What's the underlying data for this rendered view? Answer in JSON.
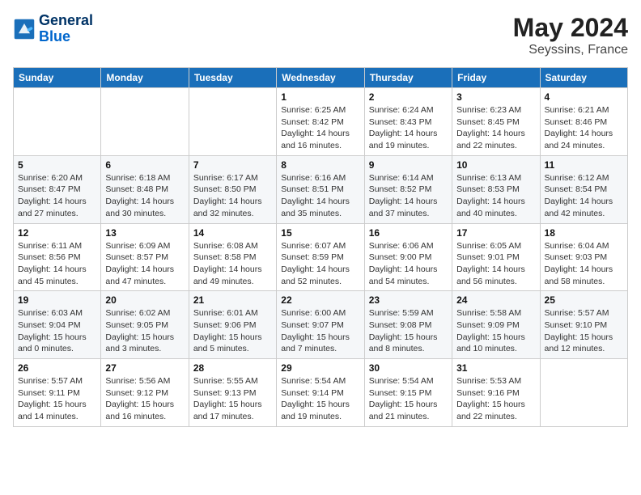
{
  "header": {
    "logo_line1": "General",
    "logo_line2": "Blue",
    "month_year": "May 2024",
    "location": "Seyssins, France"
  },
  "weekdays": [
    "Sunday",
    "Monday",
    "Tuesday",
    "Wednesday",
    "Thursday",
    "Friday",
    "Saturday"
  ],
  "weeks": [
    [
      {
        "day": "",
        "info": ""
      },
      {
        "day": "",
        "info": ""
      },
      {
        "day": "",
        "info": ""
      },
      {
        "day": "1",
        "info": "Sunrise: 6:25 AM\nSunset: 8:42 PM\nDaylight: 14 hours\nand 16 minutes."
      },
      {
        "day": "2",
        "info": "Sunrise: 6:24 AM\nSunset: 8:43 PM\nDaylight: 14 hours\nand 19 minutes."
      },
      {
        "day": "3",
        "info": "Sunrise: 6:23 AM\nSunset: 8:45 PM\nDaylight: 14 hours\nand 22 minutes."
      },
      {
        "day": "4",
        "info": "Sunrise: 6:21 AM\nSunset: 8:46 PM\nDaylight: 14 hours\nand 24 minutes."
      }
    ],
    [
      {
        "day": "5",
        "info": "Sunrise: 6:20 AM\nSunset: 8:47 PM\nDaylight: 14 hours\nand 27 minutes."
      },
      {
        "day": "6",
        "info": "Sunrise: 6:18 AM\nSunset: 8:48 PM\nDaylight: 14 hours\nand 30 minutes."
      },
      {
        "day": "7",
        "info": "Sunrise: 6:17 AM\nSunset: 8:50 PM\nDaylight: 14 hours\nand 32 minutes."
      },
      {
        "day": "8",
        "info": "Sunrise: 6:16 AM\nSunset: 8:51 PM\nDaylight: 14 hours\nand 35 minutes."
      },
      {
        "day": "9",
        "info": "Sunrise: 6:14 AM\nSunset: 8:52 PM\nDaylight: 14 hours\nand 37 minutes."
      },
      {
        "day": "10",
        "info": "Sunrise: 6:13 AM\nSunset: 8:53 PM\nDaylight: 14 hours\nand 40 minutes."
      },
      {
        "day": "11",
        "info": "Sunrise: 6:12 AM\nSunset: 8:54 PM\nDaylight: 14 hours\nand 42 minutes."
      }
    ],
    [
      {
        "day": "12",
        "info": "Sunrise: 6:11 AM\nSunset: 8:56 PM\nDaylight: 14 hours\nand 45 minutes."
      },
      {
        "day": "13",
        "info": "Sunrise: 6:09 AM\nSunset: 8:57 PM\nDaylight: 14 hours\nand 47 minutes."
      },
      {
        "day": "14",
        "info": "Sunrise: 6:08 AM\nSunset: 8:58 PM\nDaylight: 14 hours\nand 49 minutes."
      },
      {
        "day": "15",
        "info": "Sunrise: 6:07 AM\nSunset: 8:59 PM\nDaylight: 14 hours\nand 52 minutes."
      },
      {
        "day": "16",
        "info": "Sunrise: 6:06 AM\nSunset: 9:00 PM\nDaylight: 14 hours\nand 54 minutes."
      },
      {
        "day": "17",
        "info": "Sunrise: 6:05 AM\nSunset: 9:01 PM\nDaylight: 14 hours\nand 56 minutes."
      },
      {
        "day": "18",
        "info": "Sunrise: 6:04 AM\nSunset: 9:03 PM\nDaylight: 14 hours\nand 58 minutes."
      }
    ],
    [
      {
        "day": "19",
        "info": "Sunrise: 6:03 AM\nSunset: 9:04 PM\nDaylight: 15 hours\nand 0 minutes."
      },
      {
        "day": "20",
        "info": "Sunrise: 6:02 AM\nSunset: 9:05 PM\nDaylight: 15 hours\nand 3 minutes."
      },
      {
        "day": "21",
        "info": "Sunrise: 6:01 AM\nSunset: 9:06 PM\nDaylight: 15 hours\nand 5 minutes."
      },
      {
        "day": "22",
        "info": "Sunrise: 6:00 AM\nSunset: 9:07 PM\nDaylight: 15 hours\nand 7 minutes."
      },
      {
        "day": "23",
        "info": "Sunrise: 5:59 AM\nSunset: 9:08 PM\nDaylight: 15 hours\nand 8 minutes."
      },
      {
        "day": "24",
        "info": "Sunrise: 5:58 AM\nSunset: 9:09 PM\nDaylight: 15 hours\nand 10 minutes."
      },
      {
        "day": "25",
        "info": "Sunrise: 5:57 AM\nSunset: 9:10 PM\nDaylight: 15 hours\nand 12 minutes."
      }
    ],
    [
      {
        "day": "26",
        "info": "Sunrise: 5:57 AM\nSunset: 9:11 PM\nDaylight: 15 hours\nand 14 minutes."
      },
      {
        "day": "27",
        "info": "Sunrise: 5:56 AM\nSunset: 9:12 PM\nDaylight: 15 hours\nand 16 minutes."
      },
      {
        "day": "28",
        "info": "Sunrise: 5:55 AM\nSunset: 9:13 PM\nDaylight: 15 hours\nand 17 minutes."
      },
      {
        "day": "29",
        "info": "Sunrise: 5:54 AM\nSunset: 9:14 PM\nDaylight: 15 hours\nand 19 minutes."
      },
      {
        "day": "30",
        "info": "Sunrise: 5:54 AM\nSunset: 9:15 PM\nDaylight: 15 hours\nand 21 minutes."
      },
      {
        "day": "31",
        "info": "Sunrise: 5:53 AM\nSunset: 9:16 PM\nDaylight: 15 hours\nand 22 minutes."
      },
      {
        "day": "",
        "info": ""
      }
    ]
  ]
}
